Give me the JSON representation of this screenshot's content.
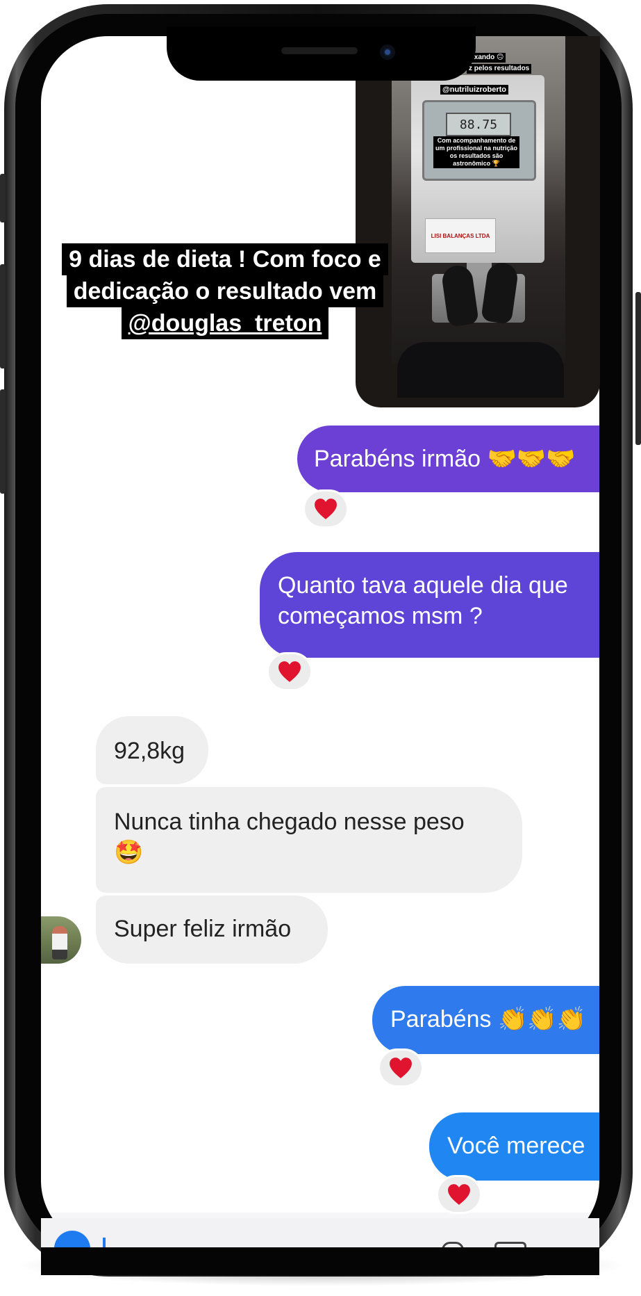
{
  "story": {
    "caption_line1": "9 dias de dieta ! Com foco e",
    "caption_line2": "dedicação o resultado vem",
    "caption_mention": "@douglas_treton",
    "photo_tags": {
      "tag1": "ixando 🙃",
      "tag2": "z pelos resultados",
      "tag3": "@nutriluizroberto",
      "tag4": "Com acompanhamento de um profissional na nutrição os resultados são astronômico 🏆",
      "scale_reading": "88.75"
    }
  },
  "messages": [
    {
      "direction": "out",
      "text": "Parabéns irmão 🤝🤝🤝",
      "reaction": "heart"
    },
    {
      "direction": "out",
      "line1": "Quanto tava aquele dia que",
      "line2": "começamos msm ?",
      "reaction": "heart"
    },
    {
      "direction": "in",
      "text": "92,8kg"
    },
    {
      "direction": "in",
      "line1": "Nunca tinha chegado nesse peso",
      "line2": "🤩"
    },
    {
      "direction": "in",
      "text": "Super feliz irmão"
    },
    {
      "direction": "out",
      "text": "Parabéns 👏👏👏",
      "reaction": "heart"
    },
    {
      "direction": "out",
      "text": "Você merece",
      "reaction": "heart"
    }
  ],
  "colors": {
    "bubble_purple": "#6c40d4",
    "bubble_blue": "#2f7bed",
    "bubble_incoming": "#efefef",
    "heart": "#e0142e"
  }
}
